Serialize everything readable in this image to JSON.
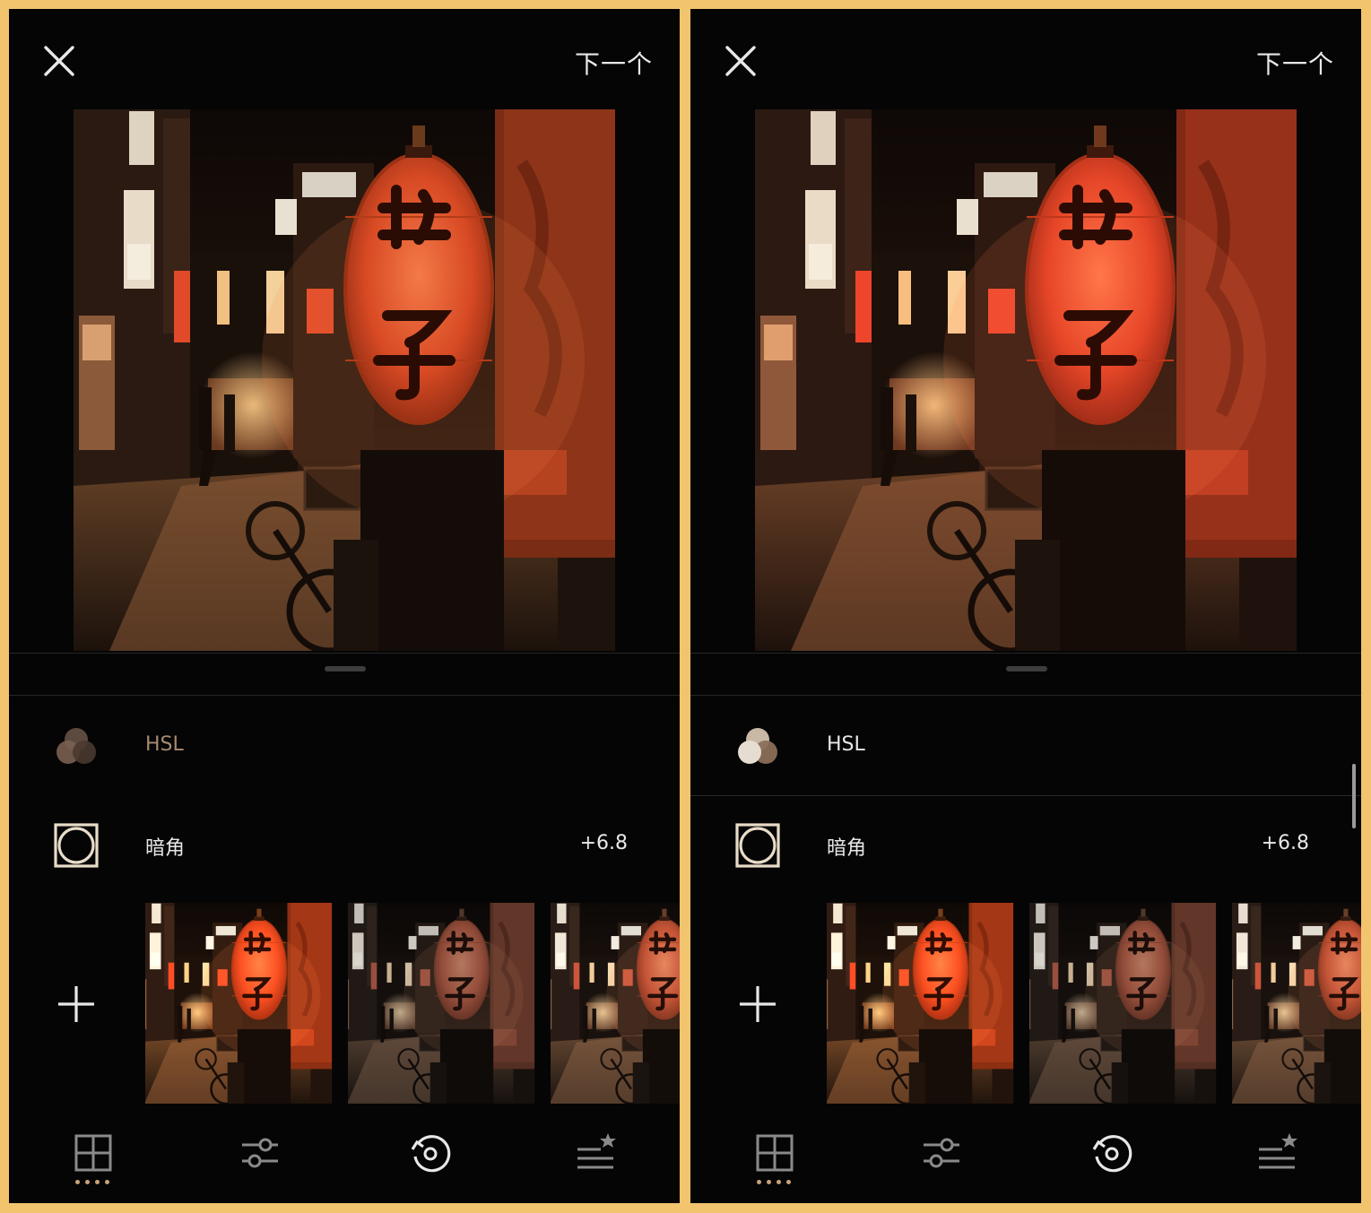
{
  "screens": [
    {
      "header": {
        "close_icon": "close-icon",
        "next_label": "下一个"
      },
      "tools": [
        {
          "icon": "hsl-icon",
          "label": "HSL",
          "value": "",
          "active": false
        },
        {
          "icon": "vignette-icon",
          "label": "暗角",
          "value": "+6.8",
          "active": true
        }
      ],
      "add_icon": "plus-icon",
      "nav": [
        "presets-grid-icon",
        "adjust-sliders-icon",
        "history-icon",
        "recipes-icon"
      ],
      "show_scrollbar": false
    },
    {
      "header": {
        "close_icon": "close-icon",
        "next_label": "下一个"
      },
      "tools": [
        {
          "icon": "hsl-icon",
          "label": "HSL",
          "value": "",
          "active": true
        },
        {
          "icon": "vignette-icon",
          "label": "暗角",
          "value": "+6.8",
          "active": true
        }
      ],
      "add_icon": "plus-icon",
      "nav": [
        "presets-grid-icon",
        "adjust-sliders-icon",
        "history-icon",
        "recipes-icon"
      ],
      "show_scrollbar": true
    }
  ],
  "colors": {
    "frame": "#f2c46e",
    "background": "#050505",
    "accent": "#c9a27a",
    "lantern": "#e0512a"
  }
}
